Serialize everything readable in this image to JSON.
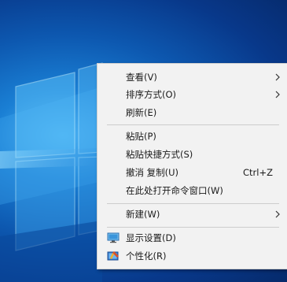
{
  "desktop": {
    "accent": "#0d58b0"
  },
  "context_menu": {
    "view": {
      "label": "查看(V)"
    },
    "sort_by": {
      "label": "排序方式(O)"
    },
    "refresh": {
      "label": "刷新(E)"
    },
    "paste": {
      "label": "粘贴(P)"
    },
    "paste_shortcut": {
      "label": "粘贴快捷方式(S)"
    },
    "undo_copy": {
      "label": "撤消 复制(U)",
      "shortcut": "Ctrl+Z"
    },
    "open_cmd": {
      "label": "在此处打开命令窗口(W)"
    },
    "new": {
      "label": "新建(W)"
    },
    "display_settings": {
      "label": "显示设置(D)",
      "icon": "monitor-icon"
    },
    "personalize": {
      "label": "个性化(R)",
      "icon": "personalize-icon"
    }
  }
}
